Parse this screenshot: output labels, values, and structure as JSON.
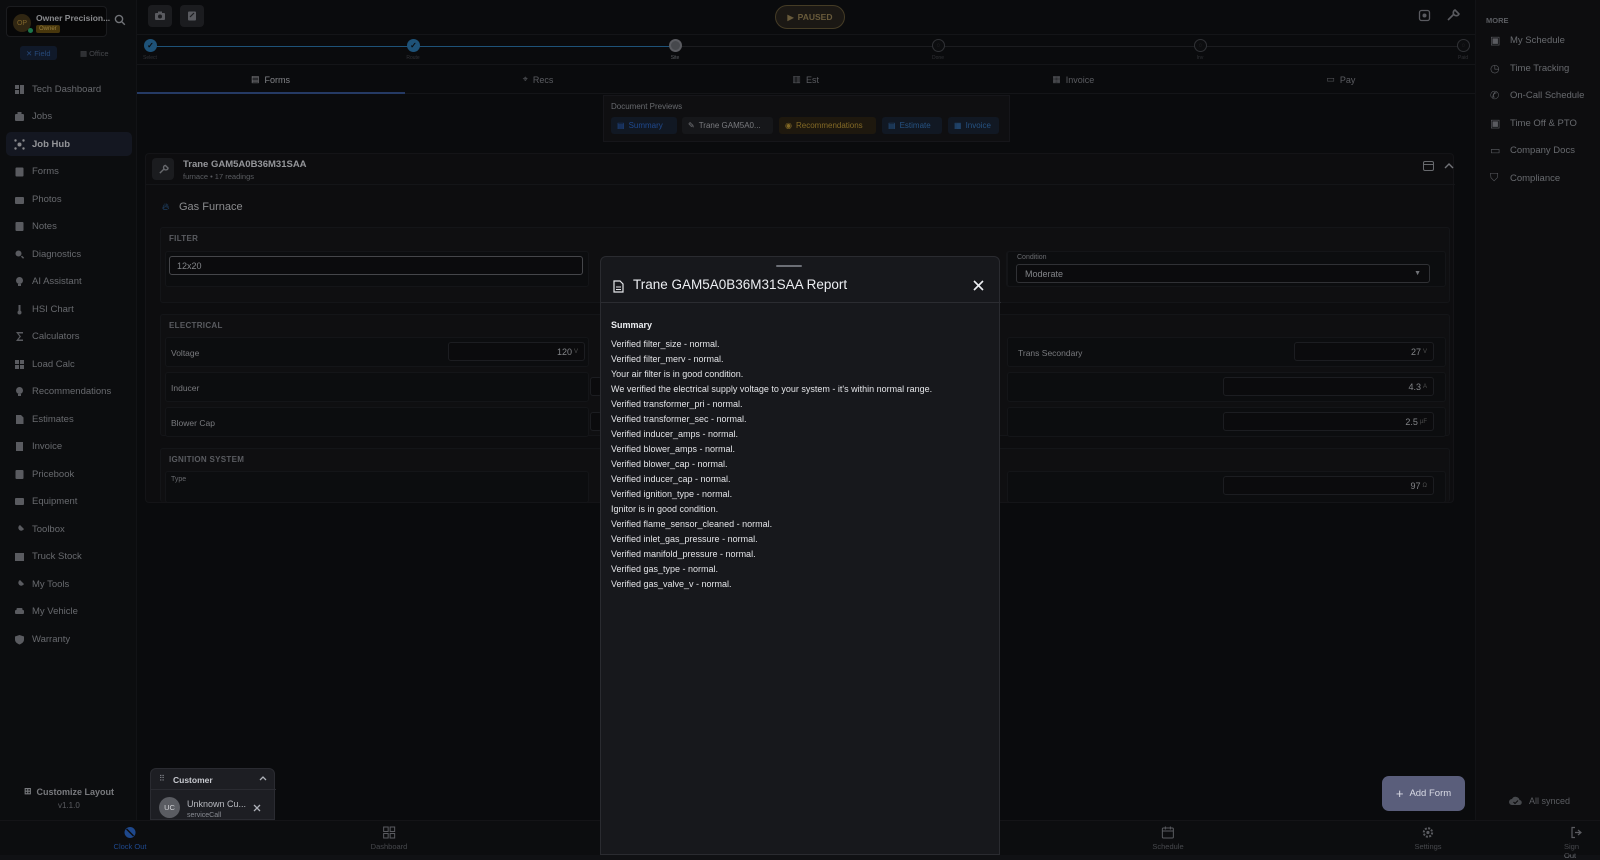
{
  "brand": {
    "initials": "OP",
    "name": "Owner Precision...",
    "badge": "Owner"
  },
  "modes": {
    "field": "Field",
    "office": "Office"
  },
  "nav": [
    {
      "label": "Tech Dashboard",
      "icon": "dashboard-icon"
    },
    {
      "label": "Jobs",
      "icon": "briefcase-icon"
    },
    {
      "label": "Job Hub",
      "icon": "hub-icon",
      "active": true
    },
    {
      "label": "Forms",
      "icon": "clipboard-icon"
    },
    {
      "label": "Photos",
      "icon": "camera-icon"
    },
    {
      "label": "Notes",
      "icon": "note-icon"
    },
    {
      "label": "Diagnostics",
      "icon": "magnifier-icon"
    },
    {
      "label": "AI Assistant",
      "icon": "lightbulb-icon"
    },
    {
      "label": "HSI Chart",
      "icon": "thermometer-icon"
    },
    {
      "label": "Calculators",
      "icon": "sigma-icon"
    },
    {
      "label": "Load Calc",
      "icon": "grid-icon"
    },
    {
      "label": "Recommendations",
      "icon": "bulb-icon"
    },
    {
      "label": "Estimates",
      "icon": "document-icon"
    },
    {
      "label": "Invoice",
      "icon": "invoice-icon"
    },
    {
      "label": "Pricebook",
      "icon": "book-icon"
    },
    {
      "label": "Equipment",
      "icon": "equipment-icon"
    },
    {
      "label": "Toolbox",
      "icon": "toolbox-icon"
    },
    {
      "label": "Truck Stock",
      "icon": "box-icon"
    },
    {
      "label": "My Tools",
      "icon": "wrench-icon"
    },
    {
      "label": "My Vehicle",
      "icon": "car-icon"
    },
    {
      "label": "Warranty",
      "icon": "shield-icon"
    }
  ],
  "customize": {
    "label": "Customize Layout",
    "version": "v1.1.0"
  },
  "timer": {
    "label": "PAUSED"
  },
  "steps": [
    {
      "label": "Select"
    },
    {
      "label": "Route"
    },
    {
      "label": "Site"
    },
    {
      "label": "Done"
    },
    {
      "label": "Inv"
    },
    {
      "label": "Paid"
    }
  ],
  "tabs": [
    {
      "label": "Forms"
    },
    {
      "label": "Recs"
    },
    {
      "label": "Est"
    },
    {
      "label": "Invoice"
    },
    {
      "label": "Pay"
    }
  ],
  "docs": {
    "title": "Document Previews",
    "chips": [
      "Summary",
      "Trane GAM5A0...",
      "Recommendations",
      "Estimate",
      "Invoice"
    ]
  },
  "equipment": {
    "title": "Trane GAM5A0B36M31SAA",
    "subtitle": "furnace • 17 readings",
    "system": "Gas Furnace",
    "sections": {
      "filter": "FILTER",
      "electrical": "ELECTRICAL",
      "ignition": "IGNITION SYSTEM"
    },
    "filter_size": "12x20",
    "filter_partial": "0",
    "condition_label": "Condition",
    "condition_value": "Moderate",
    "voltage_label": "Voltage",
    "voltage_value": "120",
    "voltage_unit": "V",
    "partial_unit": "V",
    "trans_label": "Trans Secondary",
    "trans_value": "27",
    "trans_unit": "V",
    "inducer_label": "Inducer",
    "inducer_value": "4.3",
    "inducer_unit": "A",
    "blowercap_label": "Blower Cap",
    "blowercap_value": "2.5",
    "blowercap_unit": "µF",
    "type_label": "Type",
    "ohm_value": "97",
    "ohm_unit": "Ω"
  },
  "modal": {
    "title": "Trane GAM5A0B36M31SAA Report",
    "heading": "Summary",
    "lines": [
      "Verified filter_size - normal.",
      "Verified filter_merv - normal.",
      "Your air filter is in good condition.",
      "We verified the electrical supply voltage to your system - it's within normal range.",
      "Verified transformer_pri - normal.",
      "Verified transformer_sec - normal.",
      "Verified inducer_amps - normal.",
      "Verified blower_amps - normal.",
      "Verified blower_cap - normal.",
      "Verified inducer_cap - normal.",
      "Verified ignition_type - normal.",
      "Ignitor is in good condition.",
      "Verified flame_sensor_cleaned - normal.",
      "Verified inlet_gas_pressure - normal.",
      "Verified manifold_pressure - normal.",
      "Verified gas_type - normal.",
      "Verified gas_valve_v - normal."
    ]
  },
  "more": {
    "title": "MORE",
    "items": [
      "My Schedule",
      "Time Tracking",
      "On-Call Schedule",
      "Time Off & PTO",
      "Company Docs",
      "Compliance"
    ]
  },
  "sync": {
    "label": "All synced"
  },
  "customer": {
    "title": "Customer",
    "initials": "UC",
    "name": "Unknown Cu...",
    "type": "serviceCall"
  },
  "addform": {
    "label": "Add Form"
  },
  "bottom": {
    "clockout": "Clock Out",
    "dashboard": "Dashboard",
    "schedule": "Schedule",
    "settings": "Settings",
    "signout": "Sign Out"
  },
  "colors": {
    "accent": "#2f6fd8",
    "active_nav": "#1f2434",
    "paused": "#a08a5a",
    "recommendation": "#c8a03a",
    "teal": "#3aa0b8"
  }
}
